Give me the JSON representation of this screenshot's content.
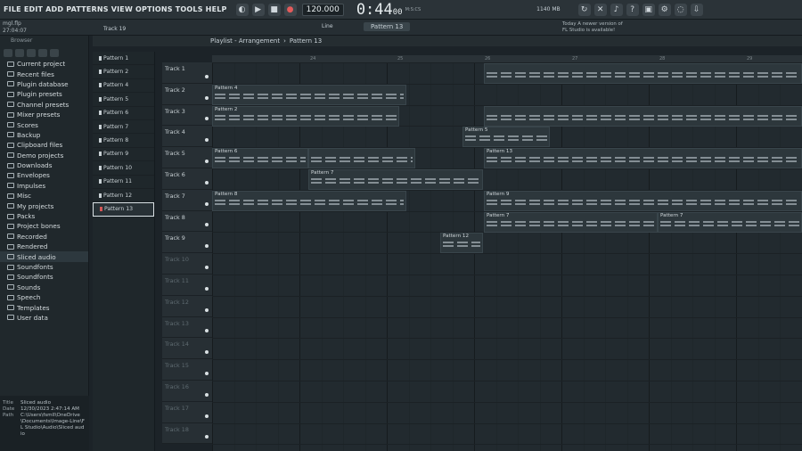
{
  "menu": [
    "FILE",
    "EDIT",
    "ADD",
    "PATTERNS",
    "VIEW",
    "OPTIONS",
    "TOOLS",
    "HELP"
  ],
  "transport": {
    "tempo": "120.000",
    "time_main": "0:44",
    "time_sub": "00",
    "time_label": "M:S:CS",
    "cpu": "1140 MB",
    "cpu2": "0"
  },
  "project": {
    "file": "mgl.flp",
    "time": "27:04:07",
    "track": "Track 19"
  },
  "toolbar2": {
    "snap": "Line",
    "pattern": "Pattern 13",
    "news": "Today  A newer version of FL Studio is available!"
  },
  "browser": {
    "title": "Browser",
    "items": [
      "Current project",
      "Recent files",
      "Plugin database",
      "Plugin presets",
      "Channel presets",
      "Mixer presets",
      "Scores",
      "Backup",
      "Clipboard files",
      "Demo projects",
      "Downloads",
      "Envelopes",
      "Impulses",
      "Misc",
      "My projects",
      "Packs",
      "Project bones",
      "Recorded",
      "Rendered",
      "Sliced audio",
      "Soundfonts",
      "Soundfonts",
      "Sounds",
      "Speech",
      "Templates",
      "User data"
    ],
    "active": 19,
    "info": {
      "title_k": "Title",
      "title_v": "Sliced audio",
      "date_k": "Date",
      "date_v": "12/30/2023 2:47:14 AM",
      "path_k": "Path",
      "path_v": "C:\\Users\\fsmll\\OneDrive\\Documents\\Image-Line\\FL Studio\\Audio\\Sliced audio"
    }
  },
  "playlist": {
    "title": "Playlist - Arrangement",
    "current": "Pattern 13"
  },
  "patterns": [
    "Pattern 1",
    "Pattern 2",
    "Pattern 4",
    "Pattern 5",
    "Pattern 6",
    "Pattern 7",
    "Pattern 8",
    "Pattern 9",
    "Pattern 10",
    "Pattern 11",
    "Pattern 12",
    "Pattern 13"
  ],
  "tracks": [
    "Track 1",
    "Track 2",
    "Track 3",
    "Track 4",
    "Track 5",
    "Track 6",
    "Track 7",
    "Track 8",
    "Track 9",
    "Track 10",
    "Track 11",
    "Track 12",
    "Track 13",
    "Track 14",
    "Track 15",
    "Track 16",
    "Track 17",
    "Track 18"
  ],
  "ruler": [
    "24",
    "25",
    "26",
    "27",
    "28",
    "29"
  ],
  "clips": [
    {
      "track": 1,
      "label": "Pattern 4",
      "start": 0,
      "len": 218
    },
    {
      "track": 2,
      "label": "Pattern 2",
      "start": 0,
      "len": 210
    },
    {
      "track": 2,
      "label": "",
      "start": 305,
      "len": 357
    },
    {
      "track": 3,
      "label": "Pattern 5",
      "start": 281,
      "len": 98
    },
    {
      "track": 4,
      "label": "Pattern 6",
      "start": 0,
      "len": 108
    },
    {
      "track": 4,
      "label": "",
      "start": 108,
      "len": 120
    },
    {
      "track": 4,
      "label": "Pattern 13",
      "start": 305,
      "len": 357
    },
    {
      "track": 5,
      "label": "Pattern 7",
      "start": 108,
      "len": 196
    },
    {
      "track": 6,
      "label": "Pattern 8",
      "start": 0,
      "len": 218
    },
    {
      "track": 6,
      "label": "Pattern 9",
      "start": 305,
      "len": 357
    },
    {
      "track": 7,
      "label": "Pattern 7",
      "start": 305,
      "len": 195
    },
    {
      "track": 7,
      "label": "Pattern 7",
      "start": 500,
      "len": 162
    },
    {
      "track": 8,
      "label": "Pattern 12",
      "start": 256,
      "len": 48
    },
    {
      "track": 0,
      "label": "",
      "start": 305,
      "len": 357
    }
  ]
}
